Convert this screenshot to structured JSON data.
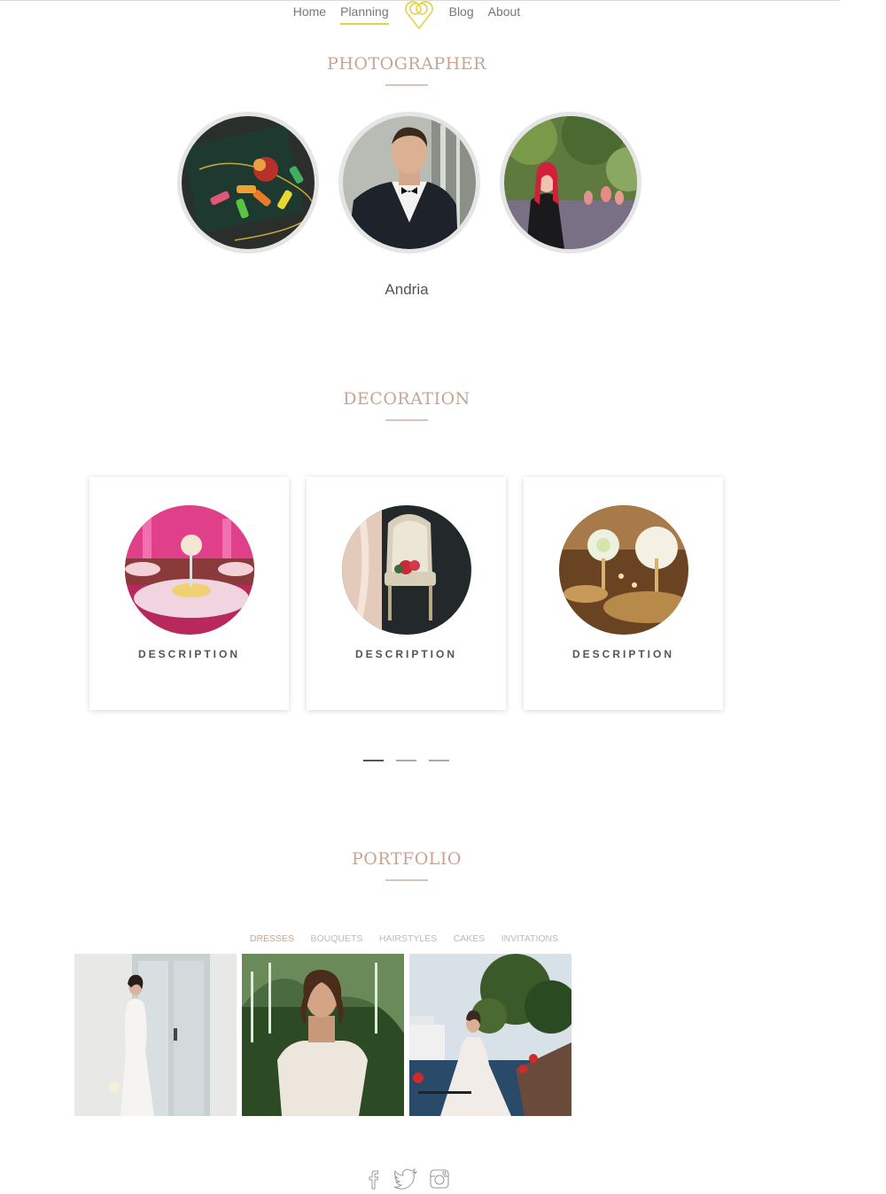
{
  "nav": {
    "items": [
      "Home",
      "Planning",
      "Blog",
      "About"
    ],
    "active": "Planning",
    "logo_icon": "wedding-rings-heart-icon",
    "accent": "#e4d24d"
  },
  "photographer": {
    "title": "PHOTOGRAPHER",
    "name": "Andria",
    "photos": [
      "thread-spools-photo",
      "groom-tuxedo-photo",
      "red-hair-woman-photo"
    ]
  },
  "decoration": {
    "title": "DECORATION",
    "cards": [
      {
        "image": "pink-banquet-hall-photo",
        "label": "DESCRIPTION"
      },
      {
        "image": "bridal-chair-photo",
        "label": "DESCRIPTION"
      },
      {
        "image": "floral-banquet-photo",
        "label": "DESCRIPTION"
      }
    ],
    "slider_dots": 3,
    "active_dot": 0
  },
  "portfolio": {
    "title": "PORTFOLIO",
    "tabs": [
      "DRESSES",
      "BOUQUETS",
      "HAIRSTYLES",
      "CAKES",
      "INVITATIONS"
    ],
    "active_tab": "DRESSES",
    "images": [
      "white-fitted-dress-photo",
      "lace-offshoulder-dress-photo",
      "waterfront-bride-photo"
    ]
  },
  "social": [
    "facebook-icon",
    "twitter-icon",
    "instagram-icon"
  ],
  "colors": {
    "title": "#c9a493",
    "rule": "#d9c4ba"
  }
}
